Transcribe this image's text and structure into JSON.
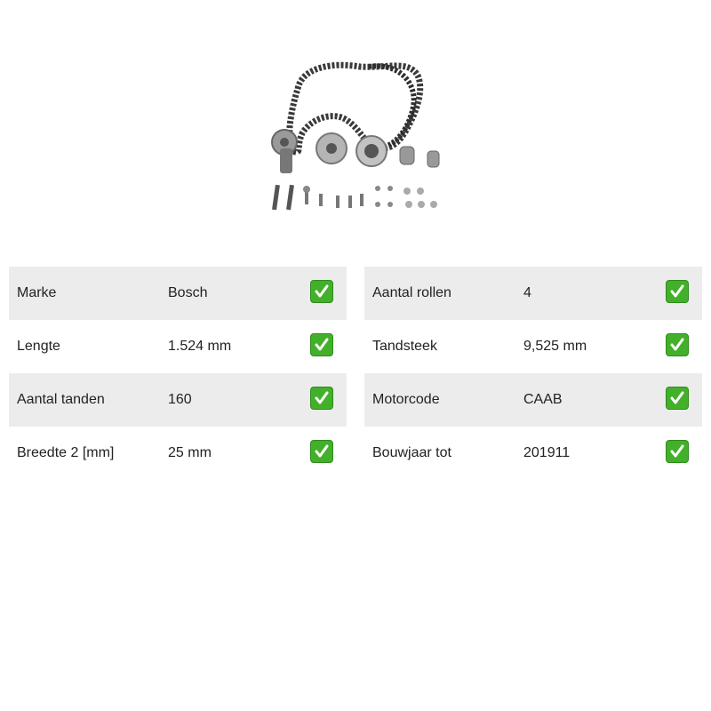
{
  "product": {
    "image_icon": "timing-belt-kit-icon"
  },
  "colors": {
    "row_shade": "#ececec",
    "check_green": "#43b02a"
  },
  "specs": {
    "left": [
      {
        "label": "Marke",
        "value": "Bosch",
        "check_icon": "green-check-icon"
      },
      {
        "label": "Lengte",
        "value": "1.524 mm",
        "check_icon": "green-check-icon"
      },
      {
        "label": "Aantal tanden",
        "value": "160",
        "check_icon": "green-check-icon"
      },
      {
        "label": "Breedte 2 [mm]",
        "value": "25 mm",
        "check_icon": "green-check-icon"
      }
    ],
    "right": [
      {
        "label": "Aantal rollen",
        "value": "4",
        "check_icon": "green-check-icon"
      },
      {
        "label": "Tandsteek",
        "value": "9,525 mm",
        "check_icon": "green-check-icon"
      },
      {
        "label": "Motorcode",
        "value": "CAAB",
        "check_icon": "green-check-icon"
      },
      {
        "label": "Bouwjaar tot",
        "value": "201911",
        "check_icon": "green-check-icon"
      }
    ]
  }
}
